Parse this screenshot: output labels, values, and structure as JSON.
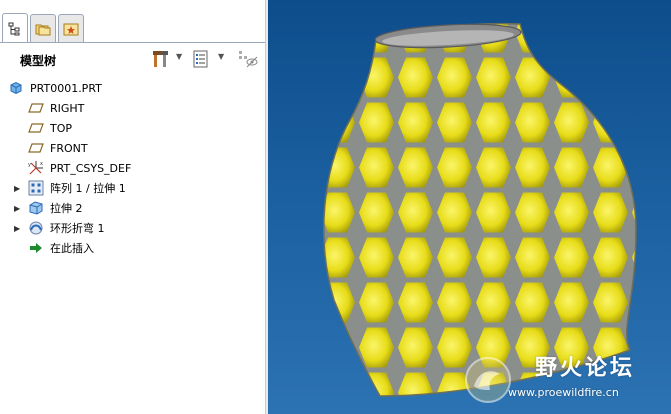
{
  "tree_panel": {
    "title": "模型树",
    "tabs": [
      {
        "name": "model-tree",
        "icon": "tree-structure-icon"
      },
      {
        "name": "folder-browser",
        "icon": "folder-icon"
      },
      {
        "name": "favorites",
        "icon": "star-icon"
      }
    ],
    "toolbar_icons": [
      "settings-tools-icon",
      "tree-columns-icon",
      "show-hide-icon"
    ]
  },
  "tree": {
    "root": {
      "label": "PRT0001.PRT",
      "icon": "part-icon"
    },
    "items": [
      {
        "label": "RIGHT",
        "icon": "datum-plane-icon",
        "expandable": false
      },
      {
        "label": "TOP",
        "icon": "datum-plane-icon",
        "expandable": false
      },
      {
        "label": "FRONT",
        "icon": "datum-plane-icon",
        "expandable": false
      },
      {
        "label": "PRT_CSYS_DEF",
        "icon": "coordinate-system-icon",
        "expandable": false
      },
      {
        "label": "阵列 1 / 拉伸 1",
        "icon": "pattern-icon",
        "expandable": true
      },
      {
        "label": "拉伸 2",
        "icon": "extrude-icon",
        "expandable": true
      },
      {
        "label": "环形折弯 1",
        "icon": "toroidal-bend-icon",
        "expandable": true
      },
      {
        "label": "在此插入",
        "icon": "insert-here-icon",
        "expandable": false
      }
    ]
  },
  "viewport": {
    "background_top": "#0e4d8c",
    "background_bottom": "#2c73b3",
    "model_color": "#f0e61e",
    "model_edge_color": "#8a8a8a"
  },
  "watermark": {
    "title": "野火论坛",
    "url": "www.proewildfire.cn"
  }
}
